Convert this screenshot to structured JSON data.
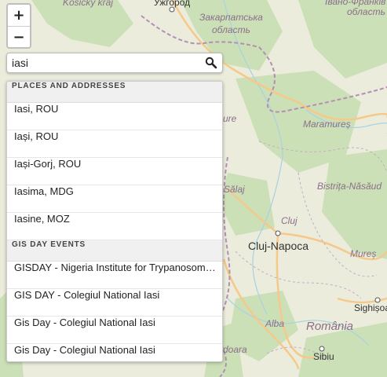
{
  "map": {
    "labels": [
      {
        "text": "Košický kraj"
      },
      {
        "text": "Ужгород"
      },
      {
        "text": "Закарпатська"
      },
      {
        "text": "область"
      },
      {
        "text": "Івано-Франків"
      },
      {
        "text": "область"
      },
      {
        "text": "Maramureș"
      },
      {
        "text": "Bistrița-Năsăud"
      },
      {
        "text": "Sălaj"
      },
      {
        "text": "Cluj"
      },
      {
        "text": "Cluj-Napoca"
      },
      {
        "text": "Mureș"
      },
      {
        "text": "Sighișoa"
      },
      {
        "text": "Alba"
      },
      {
        "text": "România"
      },
      {
        "text": "Sibiu"
      },
      {
        "text": "doara"
      },
      {
        "text": "ure"
      }
    ]
  },
  "zoom": {
    "in_label": "+",
    "out_label": "−"
  },
  "search": {
    "value": "iasi",
    "icon": "search-icon"
  },
  "results": {
    "places_header": "PLACES AND ADDRESSES",
    "places": [
      "Iasi, ROU",
      "Iași, ROU",
      "Iași-Gorj, ROU",
      "Iasima, MDG",
      "Iasine, MOZ"
    ],
    "events_header": "GIS DAY EVENTS",
    "events": [
      "GISDAY - Nigeria Institute for Trypanosomiasis Research",
      "GIS DAY - Colegiul National Iasi",
      "Gis Day - Colegiul National Iasi",
      "Gis Day - Colegiul National Iasi"
    ]
  },
  "colors": {
    "land": "#ececdc",
    "forest": "#c9dfb4",
    "border": "#b48fb5",
    "road": "#f4c98a",
    "water": "#aad3df"
  }
}
